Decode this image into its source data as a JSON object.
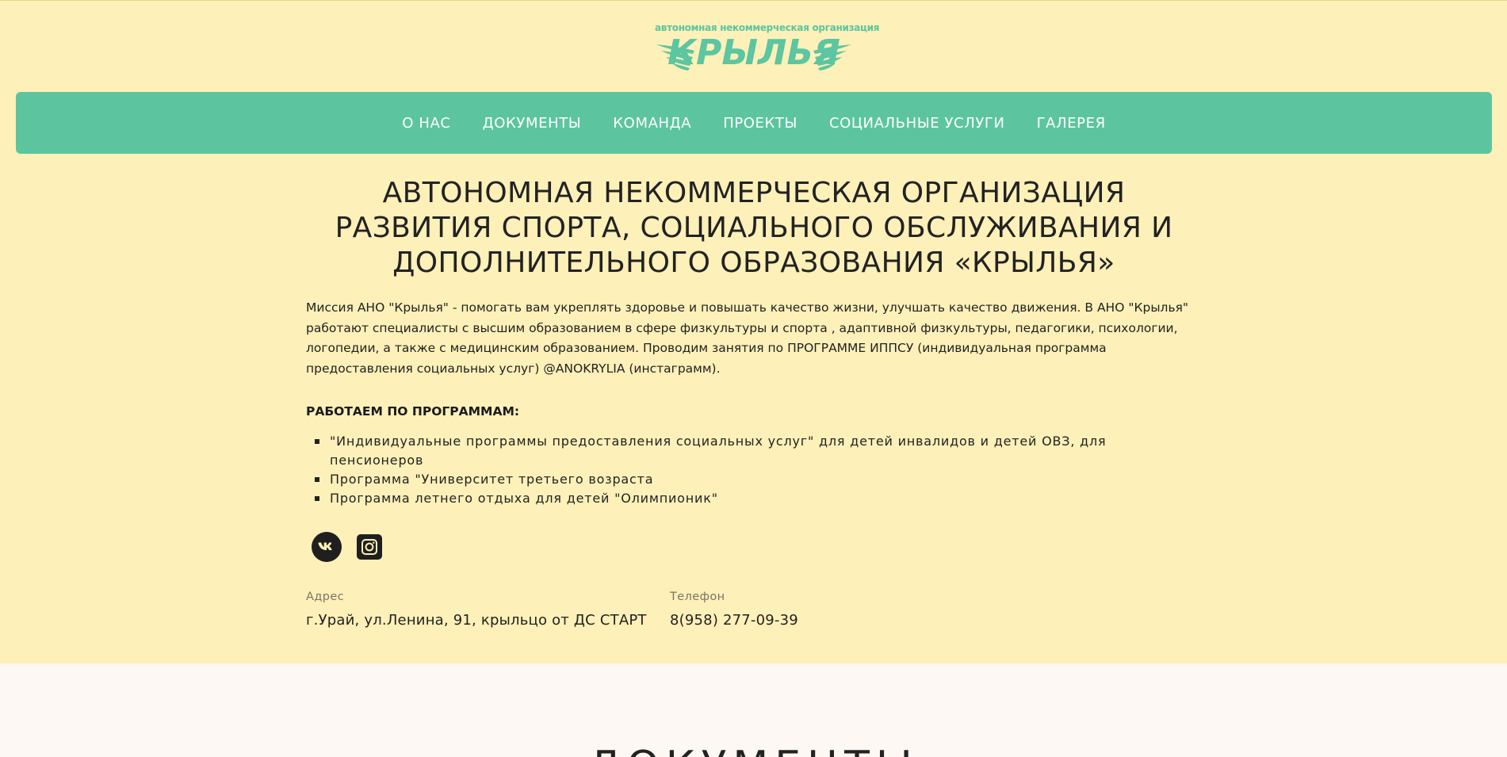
{
  "logo": {
    "caption": "автономная некоммерческая организация",
    "word": "КРЫЛЬЯ",
    "color": "#5cc5a1"
  },
  "nav": {
    "items": [
      "О НАС",
      "ДОКУМЕНТЫ",
      "КОМАНДА",
      "ПРОЕКТЫ",
      "СОЦИАЛЬНЫЕ УСЛУГИ",
      "ГАЛЕРЕЯ"
    ],
    "background": "#5cc5a0"
  },
  "hero": {
    "title": "АВТОНОМНАЯ НЕКОММЕРЧЕСКАЯ ОРГАНИЗАЦИЯ РАЗВИТИЯ СПОРТА, СОЦИАЛЬНОГО ОБСЛУЖИВАНИЯ И ДОПОЛНИТЕЛЬНОГО ОБРАЗОВАНИЯ «КРЫЛЬЯ»",
    "mission": "Миссия АНО \"Крылья\" - помогать вам укреплять здоровье и повышать качество жизни, улучшать качество движения. В АНО \"Крылья\" работают специалисты с высшим образованием в сфере физкультуры и спорта , адаптивной физкультуры, педагогики, психологии, логопедии, а также с медицинским образованием. Проводим занятия по ПРОГРАММЕ ИППСУ (индивидуальная программа предоставления социальных услуг) @ANOKRYLIA (инстаграмм).",
    "programs_title": "РАБОТАЕМ ПО ПРОГРАММАМ:",
    "programs": [
      "\"Индивидуальные программы предоставления социальных услуг\" для детей инвалидов и детей ОВЗ, для пенсионеров",
      "Программа \"Университет третьего возраста",
      "Программа летнего отдыха для детей \"Олимпионик\""
    ]
  },
  "social": {
    "icons": [
      "vk-icon",
      "instagram-icon"
    ]
  },
  "contacts": {
    "address_label": "Адрес",
    "address_value": "г.Урай, ул.Ленина, 91, крыльцо от ДС СТАРТ",
    "phone_label": "Телефон",
    "phone_value": "8(958) 277-09-39"
  },
  "docs_section": {
    "title": "ДОКУМЕНТЫ"
  },
  "colors": {
    "page_bg": "#fdf0b8",
    "accent": "#5cc5a0",
    "docs_bg": "#fdf8f3"
  }
}
